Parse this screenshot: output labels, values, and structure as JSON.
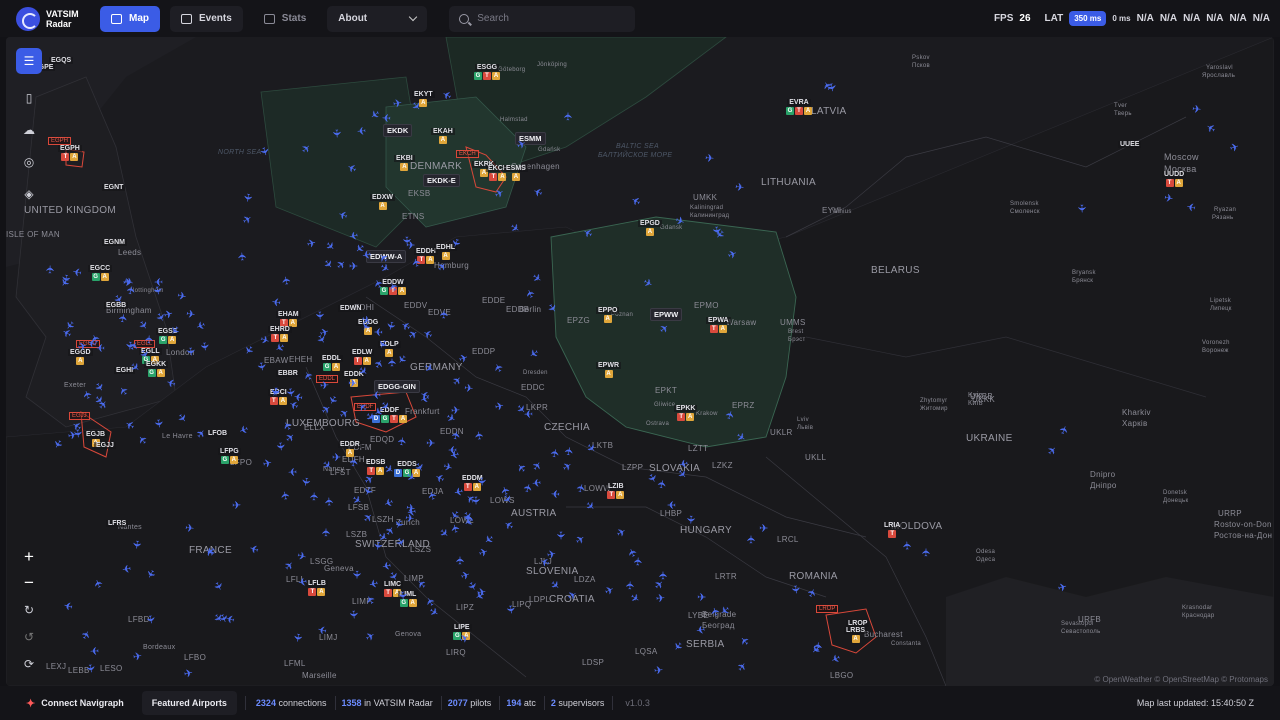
{
  "brand": {
    "name_line1": "VATSIM",
    "name_line2": "Radar",
    "icon": "vatsim-logo-icon"
  },
  "nav": {
    "map": "Map",
    "events": "Events",
    "stats": "Stats",
    "about": "About"
  },
  "search": {
    "placeholder": "Search"
  },
  "perf": {
    "fps_label": "FPS",
    "fps_value": "26",
    "lat_label": "LAT",
    "lat_value": "350 ms",
    "lat_extra": "0 ms",
    "na": [
      "N/A",
      "N/A",
      "N/A",
      "N/A",
      "N/A",
      "N/A"
    ]
  },
  "colors": {
    "accent": "#3b5ce6",
    "plane": "#4b6cf0",
    "tower": "#d94a3d",
    "approach": "#e0a63a",
    "ground": "#2aa36a",
    "delivery": "#3a6fd6"
  },
  "map": {
    "countries": [
      "UNITED KINGDOM",
      "ISLE OF MAN",
      "FRANCE",
      "LUXEMBOURG",
      "SWITZERLAND",
      "GERMANY",
      "DENMARK",
      "CZECHIA",
      "AUSTRIA",
      "SLOVENIA",
      "CROATIA",
      "HUNGARY",
      "SLOVAKIA",
      "SERBIA",
      "ROMANIA",
      "MOLDOVA",
      "UKRAINE",
      "BELARUS",
      "LITHUANIA",
      "LATVIA"
    ],
    "seas": [
      "NORTH SEA",
      "BALTIC SEA",
      "БАЛТИЙСКОЕ МОРЕ"
    ],
    "cities": [
      "Leeds",
      "Birmingham",
      "Nottingham",
      "London",
      "Exeter",
      "Le Havre",
      "Nancy",
      "Nantes",
      "Bordeaux",
      "Marseille",
      "Geneva",
      "Genova",
      "Zurich",
      "Frankfurt",
      "Dresden",
      "Berlin",
      "Hamburg",
      "Poznan",
      "Warsaw",
      "Gdansk",
      "Kaliningrad",
      "Калининград",
      "Vilnius",
      "Moscow",
      "Москва",
      "Tver",
      "Тверь",
      "Pskov",
      "Псков",
      "Yaroslavl",
      "Ярославль",
      "Smolensk",
      "Смоленск",
      "Bryansk",
      "Брянск",
      "Ryazan",
      "Рязань",
      "Lipetsk",
      "Липецк",
      "Voronezh",
      "Воронеж",
      "Kyiv",
      "Київ",
      "Zhytomyr",
      "Житомир",
      "Lviv",
      "Львів",
      "Kharkiv",
      "Харків",
      "Dnipro",
      "Дніпро",
      "Donetsk",
      "Донецьк",
      "Rostov-on-Don",
      "Ростов-на-Дон",
      "Odesa",
      "Одеса",
      "Krasnodar",
      "Краснодар",
      "Sevastopol",
      "Севастополь",
      "Constanta",
      "Bucharest",
      "Belgrade",
      "Београд",
      "Ostrava",
      "Gliwice",
      "Krakow",
      "Brest",
      "Брэст",
      "Jönköping",
      "Halmstad",
      "Göteborg",
      "Copenhagen",
      "Gdańsk"
    ],
    "airports": [
      {
        "code": "EGQS"
      },
      {
        "code": "EGPE"
      },
      {
        "code": "EGPH",
        "b": "TA"
      },
      {
        "code": "EGNT"
      },
      {
        "code": "EGCC",
        "b": "GA"
      },
      {
        "code": "EGNM"
      },
      {
        "code": "EGBB"
      },
      {
        "code": "EGGD",
        "b": "A"
      },
      {
        "code": "EGLL",
        "b": "GA"
      },
      {
        "code": "EGSS",
        "b": "GA"
      },
      {
        "code": "EGKK",
        "b": "GA"
      },
      {
        "code": "EGJB",
        "b": "A"
      },
      {
        "code": "EGJJ"
      },
      {
        "code": "EGHI"
      },
      {
        "code": "EHAM",
        "b": "TA"
      },
      {
        "code": "EHRD",
        "b": "TA"
      },
      {
        "code": "EBCI",
        "b": "TA"
      },
      {
        "code": "EBBR"
      },
      {
        "code": "LFPG",
        "b": "GA"
      },
      {
        "code": "LFOB"
      },
      {
        "code": "LFRS"
      },
      {
        "code": "EDDF",
        "b": "DGTA"
      },
      {
        "code": "EDDH",
        "b": "TA"
      },
      {
        "code": "EDDW",
        "b": "GTA"
      },
      {
        "code": "EDHL",
        "b": "A"
      },
      {
        "code": "EDDS",
        "b": "DGA"
      },
      {
        "code": "EDDM",
        "b": "TA"
      },
      {
        "code": "EDDL",
        "b": "GA"
      },
      {
        "code": "EDDK",
        "b": "A"
      },
      {
        "code": "EDLW",
        "b": "TA"
      },
      {
        "code": "EDLP",
        "b": "A"
      },
      {
        "code": "EDDG",
        "b": "A"
      },
      {
        "code": "EDWN"
      },
      {
        "code": "EDDR",
        "b": "A"
      },
      {
        "code": "EDSB",
        "b": "TA"
      },
      {
        "code": "EDXW",
        "b": "A"
      },
      {
        "code": "EKYT",
        "b": "A"
      },
      {
        "code": "EKAH",
        "b": "A"
      },
      {
        "code": "EKBI",
        "b": "A"
      },
      {
        "code": "EKRK",
        "b": "A"
      },
      {
        "code": "EKCH",
        "b": "TA"
      },
      {
        "code": "ESMS",
        "b": "A"
      },
      {
        "code": "ESGG",
        "b": "GTA"
      },
      {
        "code": "EPPO",
        "b": "A"
      },
      {
        "code": "EPWA",
        "b": "TA"
      },
      {
        "code": "EPWR",
        "b": "A"
      },
      {
        "code": "EPKK",
        "b": "TA"
      },
      {
        "code": "EPGD",
        "b": "A"
      },
      {
        "code": "EVRA",
        "b": "GTA"
      },
      {
        "code": "UUDD",
        "b": "TA"
      },
      {
        "code": "UUEE"
      },
      {
        "code": "LZIB",
        "b": "TA"
      },
      {
        "code": "LFLB",
        "b": "TA"
      },
      {
        "code": "LIMC",
        "b": "TA"
      },
      {
        "code": "LIML",
        "b": "GA"
      },
      {
        "code": "LIPE",
        "b": "GA"
      },
      {
        "code": "LRBS",
        "b": "A"
      },
      {
        "code": "LRIA",
        "b": "T"
      },
      {
        "code": "LROP"
      }
    ],
    "sectors": [
      "EKDK",
      "EKDK-E",
      "ESMM",
      "EDWW-A",
      "EDGG-GIN",
      "EPWW"
    ],
    "atc_boxes": [
      "EGPH",
      "EGGD",
      "EGLL",
      "EGJJ",
      "EKCH",
      "EDDL",
      "EDDF",
      "LROP"
    ],
    "fir_labels": [
      "ETNS",
      "EKSB",
      "EDDV",
      "EDVE",
      "EDDB",
      "EPZG",
      "EPMO",
      "EPKT",
      "EPRZ",
      "EDDP",
      "EDDN",
      "LKPR",
      "LKTB",
      "LZTT",
      "LZKZ",
      "LZPP",
      "LHBP",
      "LOWW",
      "LOWL",
      "LOWS",
      "LSZH",
      "LSGG",
      "LSZB",
      "LSZS",
      "LFLL",
      "LFML",
      "LFBD",
      "LFBO",
      "LIPQ",
      "LJLJ",
      "LDZA",
      "LDPL",
      "LDSP",
      "LQSA",
      "LYBE",
      "LRTR",
      "LRCL",
      "LBGO",
      "UKLL",
      "UKBB",
      "UMMS",
      "UMKK",
      "EYVI",
      "UKKK",
      "URRP",
      "URFB",
      "UKLR",
      "LEXJ",
      "LEBB",
      "LESO",
      "LFPO",
      "EDFH",
      "EDFM",
      "EDTF",
      "EDJA",
      "EDQD",
      "EDHI",
      "EHEH",
      "EBAW",
      "ELLX",
      "LFST",
      "LFSB",
      "EDDC",
      "EDDE",
      "LIRQ",
      "LIPZ",
      "LIMF",
      "LIMJ",
      "LIMP"
    ],
    "copyright": "© OpenWeather © OpenStreetMap © Protomaps"
  },
  "bottom": {
    "navigraph": "Connect Navigraph",
    "featured": "Featured Airports",
    "connections_n": "2324",
    "connections_l": "connections",
    "radar_n": "1358",
    "radar_l": "in VATSIM Radar",
    "pilots_n": "2077",
    "pilots_l": "pilots",
    "atc_n": "194",
    "atc_l": "atc",
    "sup_n": "2",
    "sup_l": "supervisors",
    "version": "v1.0.3",
    "updated": "Map last updated: 15:40:50 Z"
  }
}
